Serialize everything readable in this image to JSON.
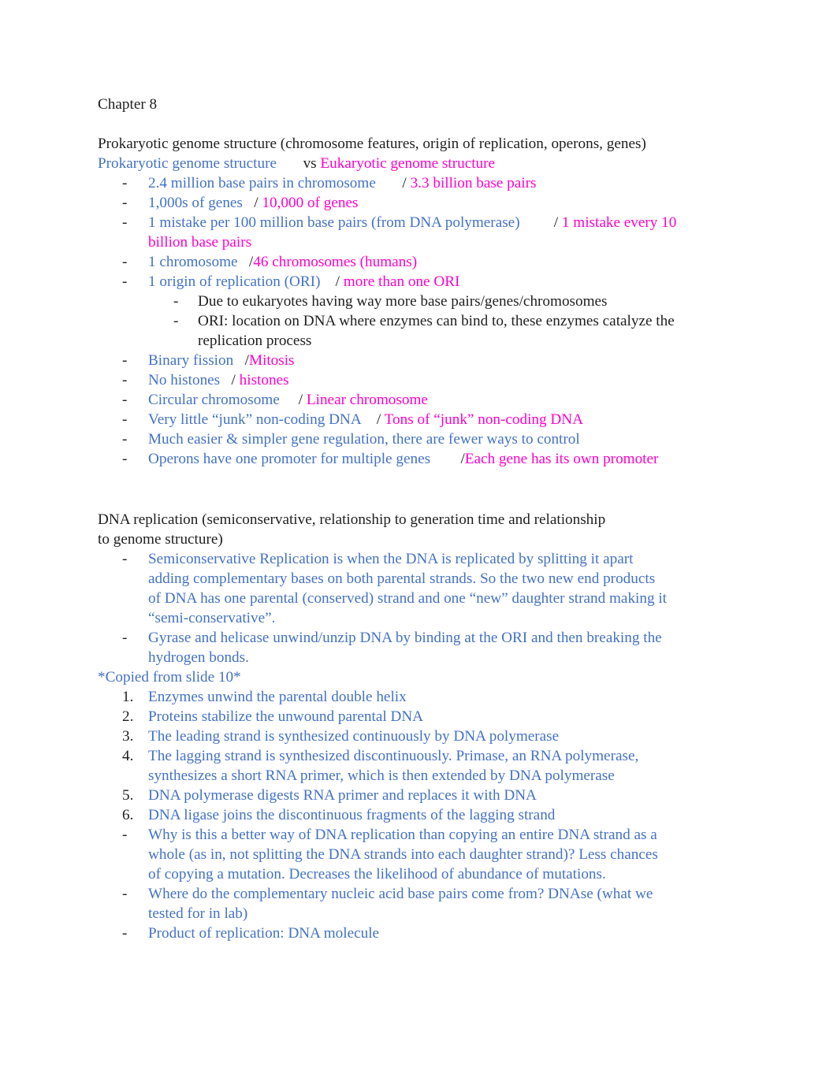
{
  "document": {
    "title": "Chapter 8",
    "colors": {
      "black": "#1f1f1f",
      "blue": "#4472c4",
      "pink": "#ff00cc"
    },
    "section1": {
      "heading": "Prokaryotic genome structure (chromosome features, origin of replication, operons, genes)",
      "subheading": {
        "left": "Prokaryotic genome structure",
        "middle": "       vs ",
        "right": "Eukaryotic genome structure"
      },
      "comparisons": [
        {
          "marker": "-",
          "prokaryote": "2.4 million base pairs in chromosome",
          "separator": "       / ",
          "eukaryote": "3.3 billion base pairs"
        },
        {
          "marker": "-",
          "prokaryote": "1,000s of genes",
          "separator": "   / ",
          "eukaryote": "10,000 of genes"
        },
        {
          "marker": "-",
          "prokaryote": "1 mistake per 100 million base pairs (from DNA polymerase)",
          "separator": "         / ",
          "eukaryote": "1 mistake every 10 billion base pairs"
        },
        {
          "marker": "-",
          "prokaryote": "1 chromosome",
          "separator": "   /",
          "eukaryote": "46 chromosomes (humans)"
        },
        {
          "marker": "-",
          "prokaryote": "1 origin of replication (ORI)",
          "separator": "    / ",
          "eukaryote": "more than one ORI"
        }
      ],
      "ori_subbullets": [
        {
          "marker": "-",
          "text": "Due to eukaryotes having way more base pairs/genes/chromosomes"
        },
        {
          "marker": "-",
          "text": "ORI: location on DNA where enzymes can bind to, these enzymes catalyze the replication process"
        }
      ],
      "comparisons2": [
        {
          "marker": "-",
          "prokaryote": "Binary fission",
          "separator": "   /",
          "eukaryote": "Mitosis"
        },
        {
          "marker": "-",
          "prokaryote": "No histones",
          "separator": "   / ",
          "eukaryote": "histones"
        },
        {
          "marker": "-",
          "prokaryote": "Circular chromosome",
          "separator": "     / ",
          "eukaryote": "Linear chromosome"
        },
        {
          "marker": "-",
          "prokaryote": "Very little “junk” non-coding DNA",
          "separator": "    / ",
          "eukaryote": "Tons of “junk” non-coding DNA"
        },
        {
          "marker": "-",
          "prokaryote": "Much easier & simpler gene regulation, there are fewer ways to control",
          "separator": "",
          "eukaryote": ""
        },
        {
          "marker": "-",
          "prokaryote": "Operons have one promoter for multiple genes",
          "separator": "        /",
          "eukaryote": "Each gene has its own promoter"
        }
      ]
    },
    "section2": {
      "heading": "DNA replication (semiconservative, relationship to generation time and relationship to genome structure)",
      "bullets_top": [
        {
          "marker": "-",
          "text": "Semiconservative Replication is when the DNA is replicated by splitting it apart adding complementary bases on both parental strands. So the two new end products of DNA has one parental (conserved) strand and one “new” daughter strand making it “semi-conservative”."
        },
        {
          "marker": "-",
          "text": "Gyrase and helicase unwind/unzip DNA by binding at the ORI and then breaking the hydrogen bonds."
        }
      ],
      "slide_note": "*Copied from slide 10*",
      "numbered_steps": [
        {
          "marker": "1.",
          "text": "Enzymes unwind the parental double helix"
        },
        {
          "marker": "2.",
          "text": "Proteins stabilize the unwound parental DNA"
        },
        {
          "marker": "3.",
          "text": "The leading strand is synthesized continuously by DNA polymerase"
        },
        {
          "marker": "4.",
          "text": "The lagging strand is synthesized discontinuously. Primase, an RNA polymerase, synthesizes a short RNA primer, which is then extended by DNA polymerase"
        },
        {
          "marker": "5.",
          "text": "DNA polymerase digests RNA primer and replaces it with DNA"
        },
        {
          "marker": "6.",
          "text": "DNA ligase joins the discontinuous fragments of the lagging strand"
        }
      ],
      "bullets_bottom": [
        {
          "marker": "-",
          "text": "Why is this a better way of DNA replication than copying an entire DNA strand as a whole (as in, not splitting the DNA strands into each daughter strand)? Less chances of copying a mutation. Decreases the likelihood of abundance of mutations."
        },
        {
          "marker": "-",
          "text": "Where do the complementary nucleic acid base pairs come from? DNAse (what we tested for in lab)"
        },
        {
          "marker": "-",
          "text": "Product of replication: DNA molecule"
        }
      ]
    }
  }
}
